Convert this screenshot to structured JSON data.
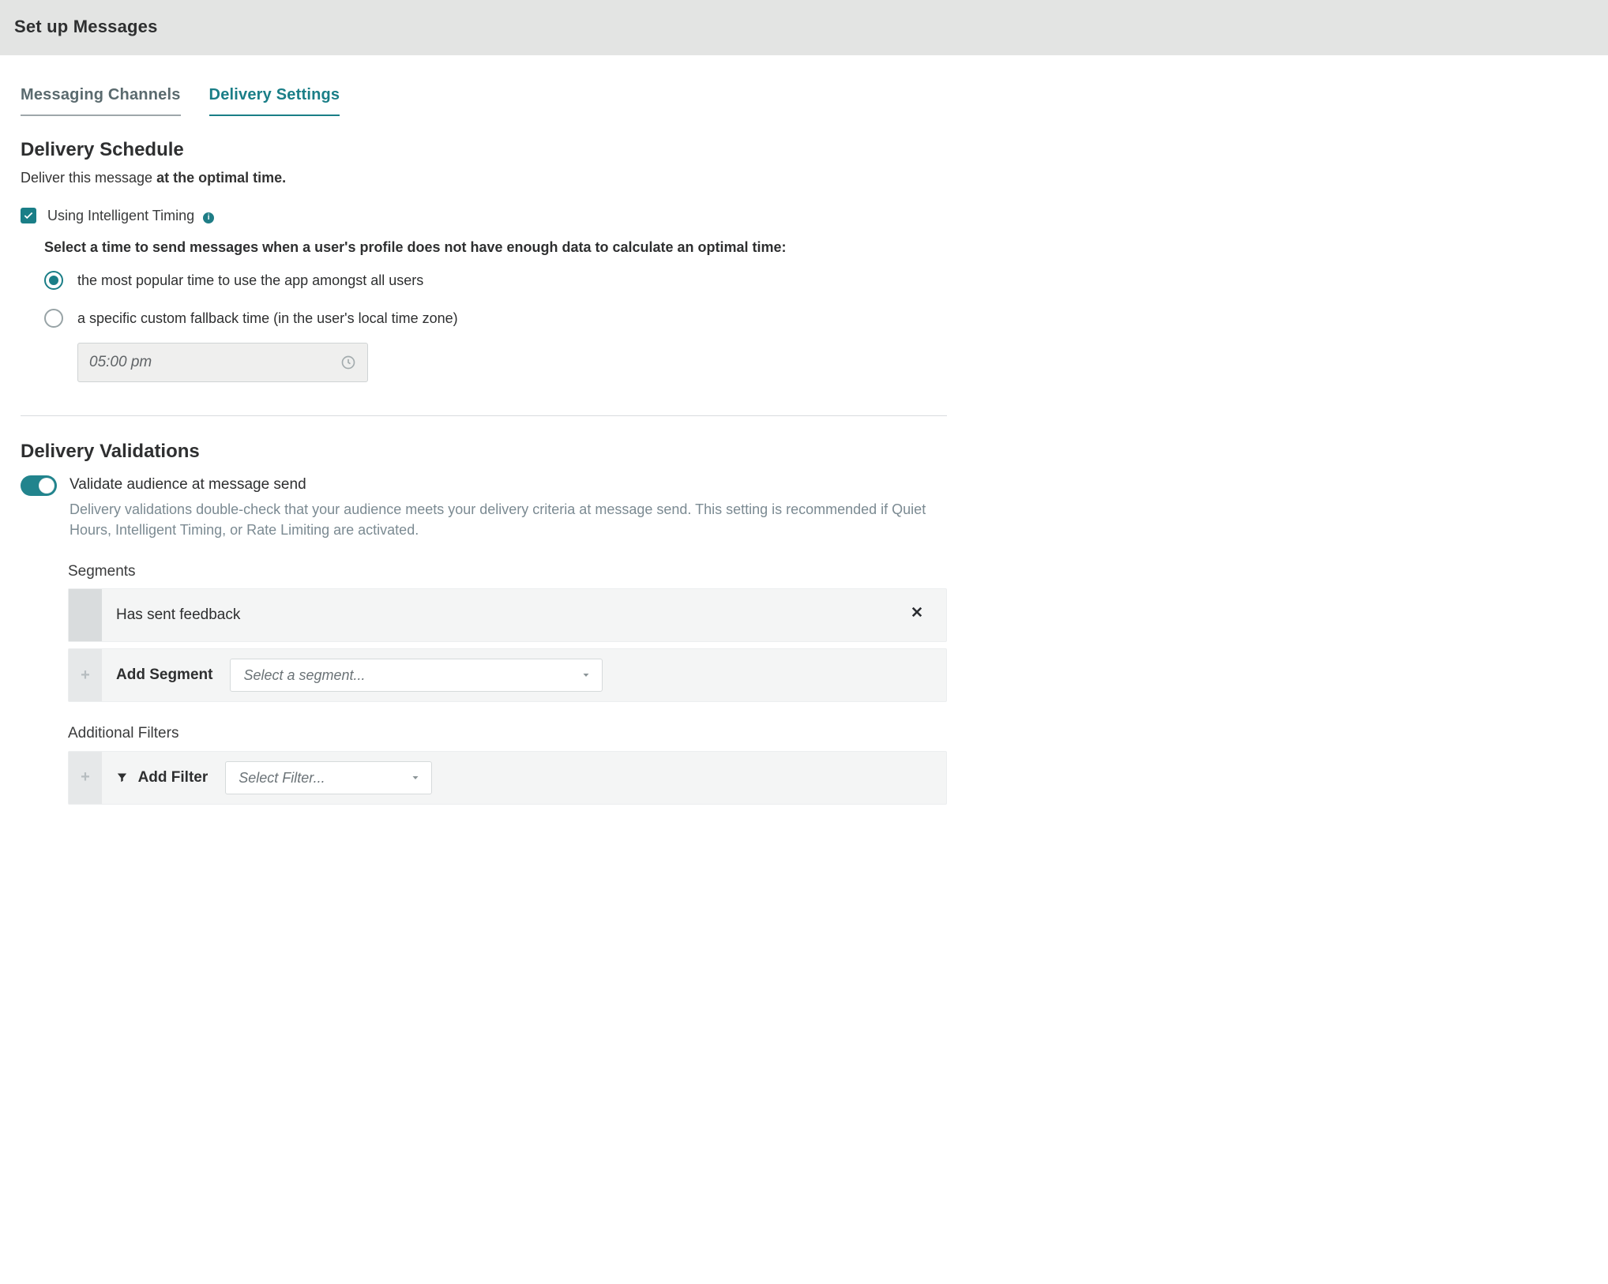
{
  "header": {
    "title": "Set up Messages"
  },
  "tabs": [
    {
      "label": "Messaging Channels",
      "active": false
    },
    {
      "label": "Delivery Settings",
      "active": true
    }
  ],
  "schedule": {
    "heading": "Delivery Schedule",
    "lead_prefix": "Deliver this message ",
    "lead_bold": "at the optimal time.",
    "checkbox_label": "Using Intelligent Timing",
    "checkbox_checked": true,
    "fallback_note": "Select a time to send messages when a user's profile does not have enough data to calculate an optimal time:",
    "options": [
      {
        "label": "the most popular time to use the app amongst all users",
        "selected": true
      },
      {
        "label": "a specific custom fallback time (in the user's local time zone)",
        "selected": false
      }
    ],
    "fallback_time_value": "05:00 pm"
  },
  "validations": {
    "heading": "Delivery Validations",
    "toggle_on": true,
    "toggle_title": "Validate audience at message send",
    "toggle_desc": "Delivery validations double-check that your audience meets your delivery criteria at message send. This setting is recommended if Quiet Hours, Intelligent Timing, or Rate Limiting are activated.",
    "segments": {
      "label": "Segments",
      "rows": [
        {
          "name": "Has sent feedback"
        }
      ],
      "add_label": "Add Segment",
      "select_placeholder": "Select a segment..."
    },
    "filters": {
      "label": "Additional Filters",
      "add_label": "Add Filter",
      "select_placeholder": "Select Filter..."
    }
  }
}
